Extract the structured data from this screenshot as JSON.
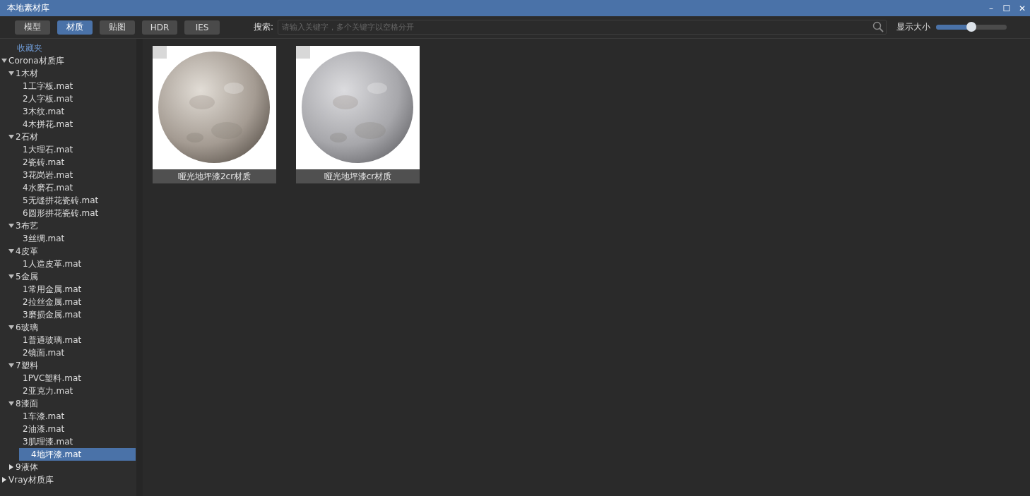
{
  "window": {
    "title": "本地素材库",
    "controls": [
      "–",
      "☐",
      "✕"
    ]
  },
  "tabs": [
    {
      "label": "模型",
      "selected": false
    },
    {
      "label": "材质",
      "selected": true
    },
    {
      "label": "贴图",
      "selected": false
    },
    {
      "label": "HDR",
      "selected": false
    },
    {
      "label": "IES",
      "selected": false
    }
  ],
  "search": {
    "label": "搜索:",
    "placeholder": "请输入关键字，多个关键字以空格分开"
  },
  "size_slider": {
    "label": "显示大小",
    "level": 0.5
  },
  "sidebar": {
    "favorites": "收藏夹",
    "tree": [
      {
        "label": "Corona材质库",
        "expanded": true,
        "selected": false,
        "children": [
          {
            "label": "1木材",
            "expanded": true,
            "selected": false,
            "children": [
              {
                "label": "1工字板.mat",
                "selected": false
              },
              {
                "label": "2人字板.mat",
                "selected": false
              },
              {
                "label": "3木纹.mat",
                "selected": false
              },
              {
                "label": "4木拼花.mat",
                "selected": false
              }
            ]
          },
          {
            "label": "2石材",
            "expanded": true,
            "selected": false,
            "children": [
              {
                "label": "1大理石.mat",
                "selected": false
              },
              {
                "label": "2瓷砖.mat",
                "selected": false
              },
              {
                "label": "3花岗岩.mat",
                "selected": false
              },
              {
                "label": "4水磨石.mat",
                "selected": false
              },
              {
                "label": "5无缝拼花瓷砖.mat",
                "selected": false
              },
              {
                "label": "6圆形拼花瓷砖.mat",
                "selected": false
              }
            ]
          },
          {
            "label": "3布艺",
            "expanded": true,
            "selected": false,
            "children": [
              {
                "label": "3丝绸.mat",
                "selected": false
              }
            ]
          },
          {
            "label": "4皮革",
            "expanded": true,
            "selected": false,
            "children": [
              {
                "label": "1人造皮革.mat",
                "selected": false
              }
            ]
          },
          {
            "label": "5金属",
            "expanded": true,
            "selected": false,
            "children": [
              {
                "label": "1常用金属.mat",
                "selected": false
              },
              {
                "label": "2拉丝金属.mat",
                "selected": false
              },
              {
                "label": "3磨损金属.mat",
                "selected": false
              }
            ]
          },
          {
            "label": "6玻璃",
            "expanded": true,
            "selected": false,
            "children": [
              {
                "label": "1普通玻璃.mat",
                "selected": false
              },
              {
                "label": "2镜面.mat",
                "selected": false
              }
            ]
          },
          {
            "label": "7塑料",
            "expanded": true,
            "selected": false,
            "children": [
              {
                "label": "1PVC塑料.mat",
                "selected": false
              },
              {
                "label": "2亚克力.mat",
                "selected": false
              }
            ]
          },
          {
            "label": "8漆面",
            "expanded": true,
            "selected": false,
            "children": [
              {
                "label": "1车漆.mat",
                "selected": false
              },
              {
                "label": "2油漆.mat",
                "selected": false
              },
              {
                "label": "3肌理漆.mat",
                "selected": false
              },
              {
                "label": "4地坪漆.mat",
                "selected": true
              }
            ]
          },
          {
            "label": "9液体",
            "expanded": false,
            "selected": false
          }
        ]
      },
      {
        "label": "Vray材质库",
        "expanded": false,
        "selected": false
      }
    ]
  },
  "materials": [
    {
      "name": "哑光地坪漆2cr材质",
      "kind": "picture"
    },
    {
      "name": "哑光地坪漆cr材质",
      "kind": "picture"
    }
  ]
}
